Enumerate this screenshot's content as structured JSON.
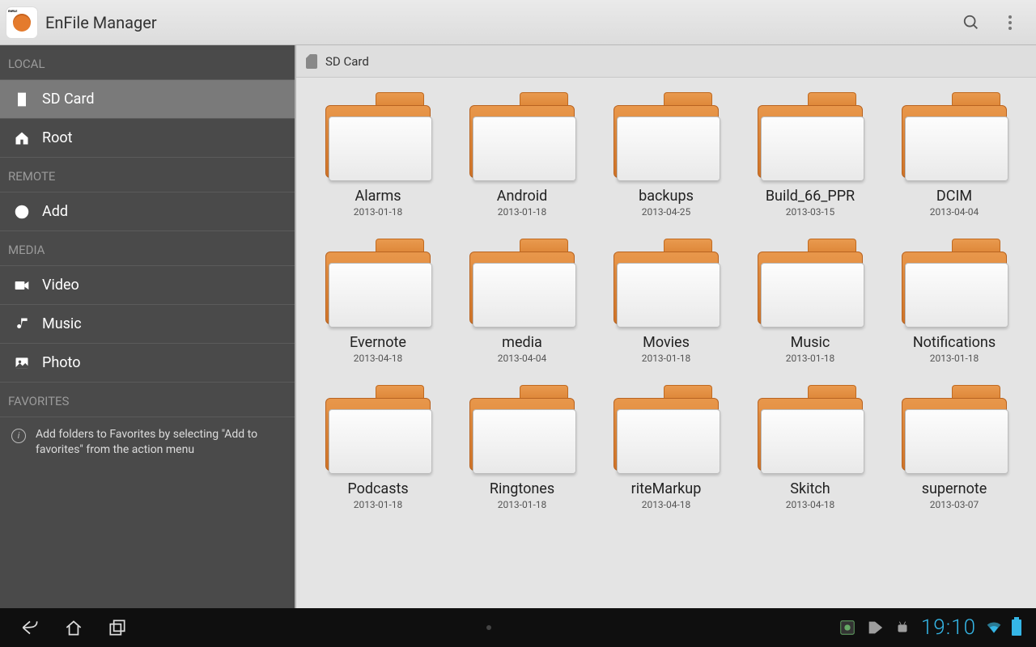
{
  "header": {
    "title": "EnFile Manager"
  },
  "sidebar": {
    "sections": {
      "local": {
        "label": "LOCAL",
        "items": [
          {
            "label": "SD Card"
          },
          {
            "label": "Root"
          }
        ]
      },
      "remote": {
        "label": "REMOTE",
        "items": [
          {
            "label": "Add"
          }
        ]
      },
      "media": {
        "label": "MEDIA",
        "items": [
          {
            "label": "Video"
          },
          {
            "label": "Music"
          },
          {
            "label": "Photo"
          }
        ]
      },
      "favorites": {
        "label": "FAVORITES",
        "hint": "Add folders to Favorites by selecting \"Add to favorites\" from the action menu"
      }
    }
  },
  "breadcrumb": {
    "label": "SD Card"
  },
  "folders": [
    {
      "name": "Alarms",
      "date": "2013-01-18"
    },
    {
      "name": "Android",
      "date": "2013-01-18"
    },
    {
      "name": "backups",
      "date": "2013-04-25"
    },
    {
      "name": "Build_66_PPR",
      "date": "2013-03-15"
    },
    {
      "name": "DCIM",
      "date": "2013-04-04"
    },
    {
      "name": "Evernote",
      "date": "2013-04-18"
    },
    {
      "name": "media",
      "date": "2013-04-04"
    },
    {
      "name": "Movies",
      "date": "2013-01-18"
    },
    {
      "name": "Music",
      "date": "2013-01-18"
    },
    {
      "name": "Notifications",
      "date": "2013-01-18"
    },
    {
      "name": "Podcasts",
      "date": "2013-01-18"
    },
    {
      "name": "Ringtones",
      "date": "2013-01-18"
    },
    {
      "name": "riteMarkup",
      "date": "2013-04-18"
    },
    {
      "name": "Skitch",
      "date": "2013-04-18"
    },
    {
      "name": "supernote",
      "date": "2013-03-07"
    }
  ],
  "system": {
    "clock": "19:10"
  }
}
